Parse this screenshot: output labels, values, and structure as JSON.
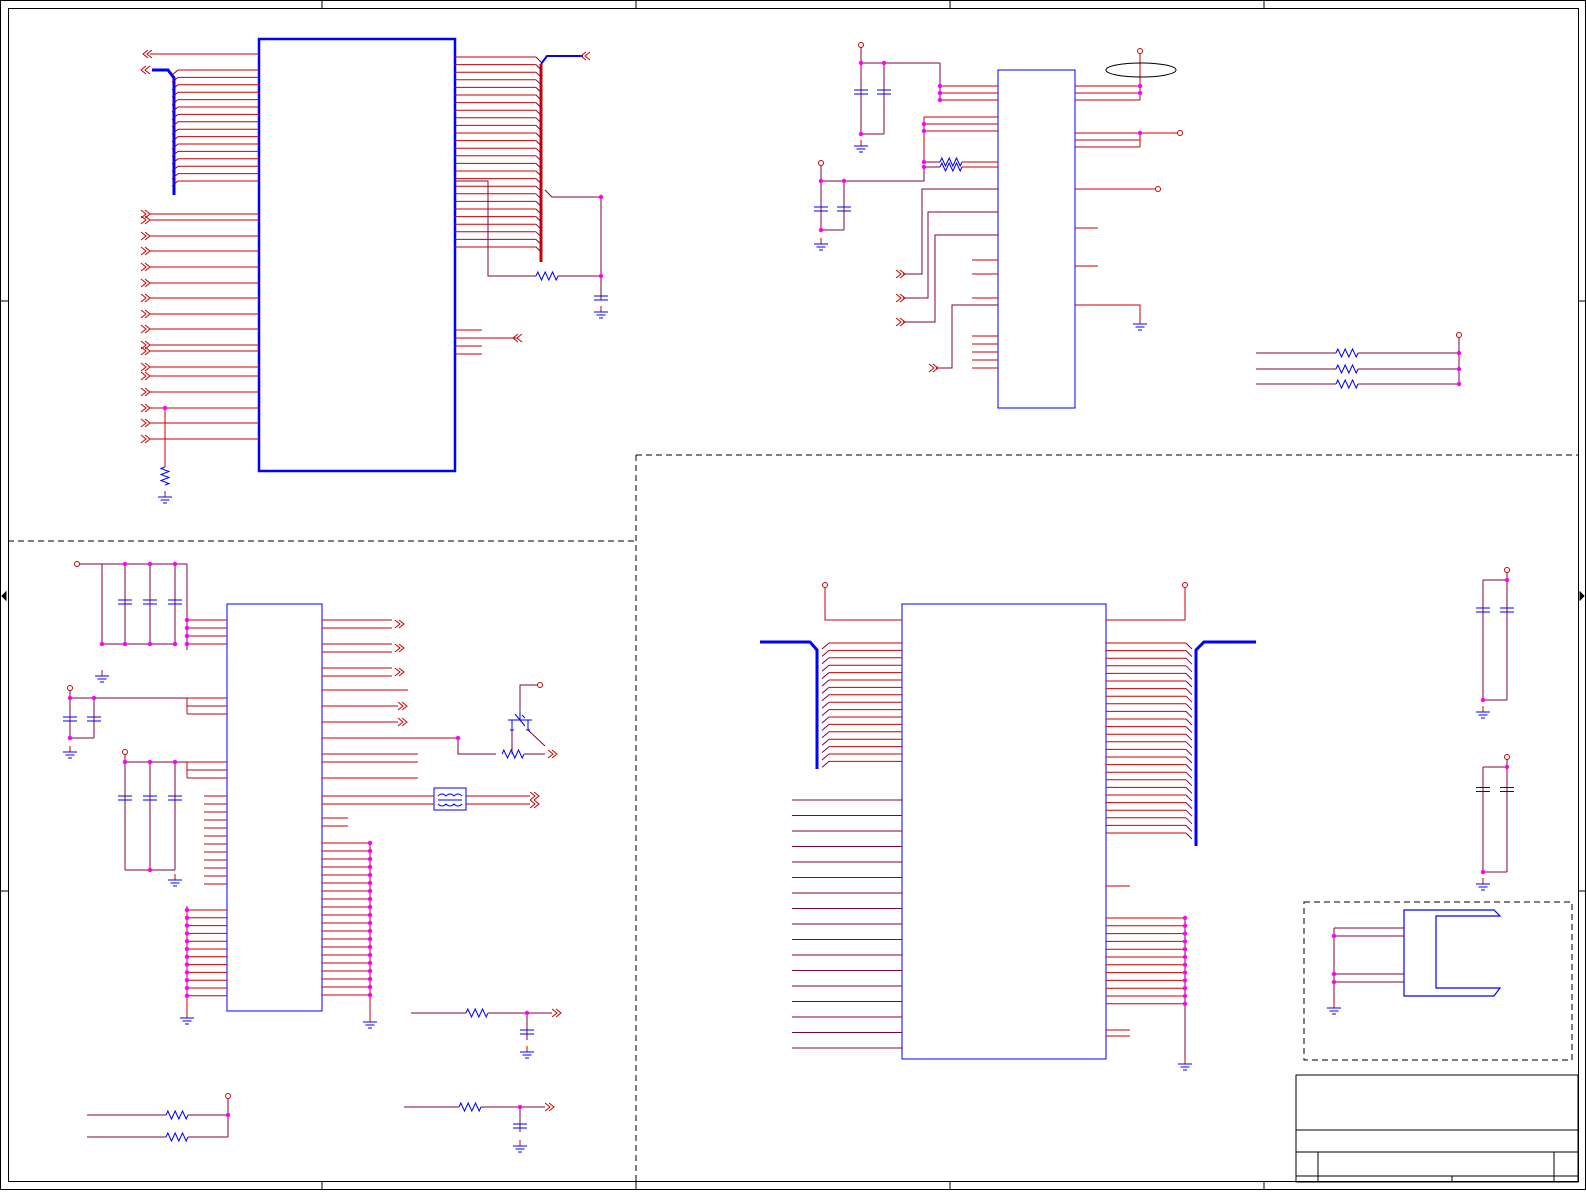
{
  "sheet": {
    "title": "",
    "text_labels": []
  },
  "colors": {
    "wire": "#cc0000",
    "net": "#800040",
    "body": "#0000ff",
    "junction": "#ff00ff",
    "frame": "#000000"
  },
  "icons": [
    "ground-icon",
    "power-pin-icon",
    "resistor-icon",
    "capacitor-icon",
    "off-page-arrow-icon",
    "transformer-icon",
    "transistor-icon"
  ]
}
